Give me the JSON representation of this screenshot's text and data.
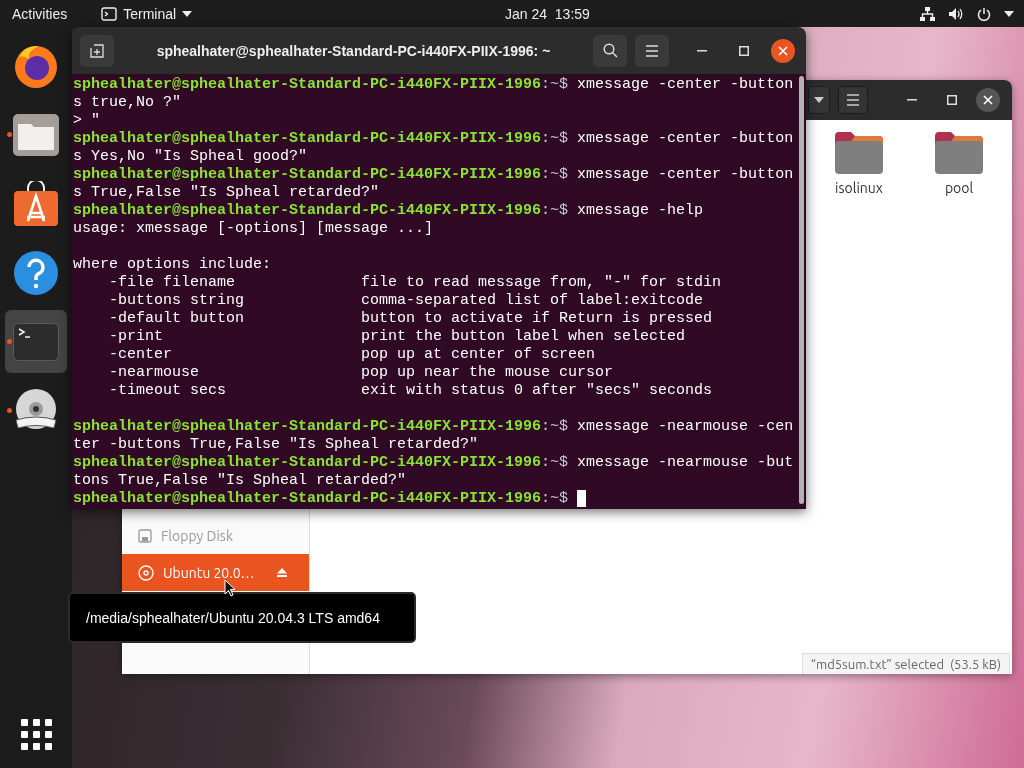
{
  "top_bar": {
    "activities": "Activities",
    "app_menu": "Terminal",
    "clock": "Jan 24  13:59"
  },
  "dock": {
    "items": [
      {
        "kind": "firefox",
        "running": false,
        "selected": false
      },
      {
        "kind": "files",
        "running": true,
        "selected": false
      },
      {
        "kind": "software",
        "running": false,
        "selected": false
      },
      {
        "kind": "help",
        "running": false,
        "selected": false
      },
      {
        "kind": "terminal",
        "running": true,
        "selected": true
      },
      {
        "kind": "dvd",
        "running": true,
        "selected": false
      }
    ]
  },
  "files_window": {
    "folders": [
      {
        "name": "isolinux"
      },
      {
        "name": "pool"
      }
    ],
    "sidebar": [
      {
        "kind": "floppy",
        "label": "Floppy Disk",
        "selected": false,
        "eject": false
      },
      {
        "kind": "disc",
        "label": "Ubuntu 20.0…",
        "selected": true,
        "eject": true
      }
    ],
    "status": "“md5sum.txt” selected  (53.5 kB)"
  },
  "terminal": {
    "title": "sphealhater@sphealhater-Standard-PC-i440FX-PIIX-1996: ~",
    "lines": [
      {
        "kind": "prompt",
        "user": "sphealhater@sphealhater-Standard-PC-i440FX-PIIX-1996",
        "path": ":~$",
        "command": "xmessage -center -button"
      },
      {
        "kind": "output",
        "text": "s true,No ?\""
      },
      {
        "kind": "output",
        "text": "> \""
      },
      {
        "kind": "prompt",
        "user": "sphealhater@sphealhater-Standard-PC-i440FX-PIIX-1996",
        "path": ":~$",
        "command": "xmessage -center -button"
      },
      {
        "kind": "output",
        "text": "s Yes,No \"Is Spheal good?\""
      },
      {
        "kind": "prompt",
        "user": "sphealhater@sphealhater-Standard-PC-i440FX-PIIX-1996",
        "path": ":~$",
        "command": "xmessage -center -button"
      },
      {
        "kind": "output",
        "text": "s True,False \"Is Spheal retarded?\""
      },
      {
        "kind": "prompt",
        "user": "sphealhater@sphealhater-Standard-PC-i440FX-PIIX-1996",
        "path": ":~$",
        "command": "xmessage -help"
      },
      {
        "kind": "output",
        "text": "usage: xmessage [-options] [message ...]"
      },
      {
        "kind": "blank"
      },
      {
        "kind": "output",
        "text": "where options include:"
      },
      {
        "kind": "output",
        "text": "    -file filename              file to read message from, \"-\" for stdin"
      },
      {
        "kind": "output",
        "text": "    -buttons string             comma-separated list of label:exitcode"
      },
      {
        "kind": "output",
        "text": "    -default button             button to activate if Return is pressed"
      },
      {
        "kind": "output",
        "text": "    -print                      print the button label when selected"
      },
      {
        "kind": "output",
        "text": "    -center                     pop up at center of screen"
      },
      {
        "kind": "output",
        "text": "    -nearmouse                  pop up near the mouse cursor"
      },
      {
        "kind": "output",
        "text": "    -timeout secs               exit with status 0 after \"secs\" seconds"
      },
      {
        "kind": "blank"
      },
      {
        "kind": "prompt",
        "user": "sphealhater@sphealhater-Standard-PC-i440FX-PIIX-1996",
        "path": ":~$",
        "command": "xmessage -nearmouse -cen"
      },
      {
        "kind": "output",
        "text": "ter -buttons True,False \"Is Spheal retarded?\""
      },
      {
        "kind": "prompt",
        "user": "sphealhater@sphealhater-Standard-PC-i440FX-PIIX-1996",
        "path": ":~$",
        "command": "xmessage -nearmouse -but"
      },
      {
        "kind": "output",
        "text": "tons True,False \"Is Spheal retarded?\""
      },
      {
        "kind": "input",
        "user": "sphealhater@sphealhater-Standard-PC-i440FX-PIIX-1996",
        "path": ":~$"
      }
    ]
  },
  "tooltip": "/media/sphealhater/Ubuntu 20.04.3 LTS amd64"
}
